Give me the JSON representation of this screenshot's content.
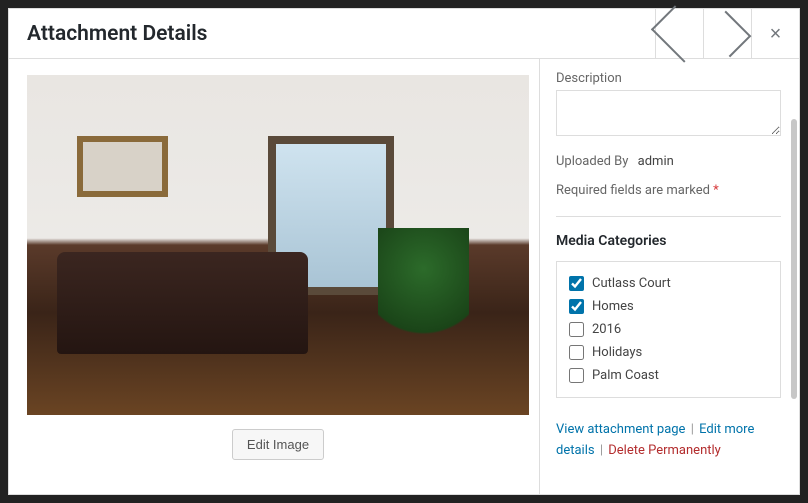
{
  "header": {
    "title": "Attachment Details"
  },
  "image": {
    "edit_label": "Edit Image"
  },
  "fields": {
    "description_label": "Description",
    "description_value": ""
  },
  "meta": {
    "uploaded_by_label": "Uploaded By",
    "uploaded_by_value": "admin",
    "required_text": "Required fields are marked",
    "required_mark": "*"
  },
  "categories": {
    "title": "Media Categories",
    "items": [
      {
        "label": "Cutlass Court",
        "checked": true
      },
      {
        "label": "Homes",
        "checked": true
      },
      {
        "label": "2016",
        "checked": false
      },
      {
        "label": "Holidays",
        "checked": false
      },
      {
        "label": "Palm Coast",
        "checked": false
      }
    ]
  },
  "links": {
    "view": "View attachment page",
    "edit_more": "Edit more details",
    "delete": "Delete Permanently",
    "sep": "|"
  }
}
